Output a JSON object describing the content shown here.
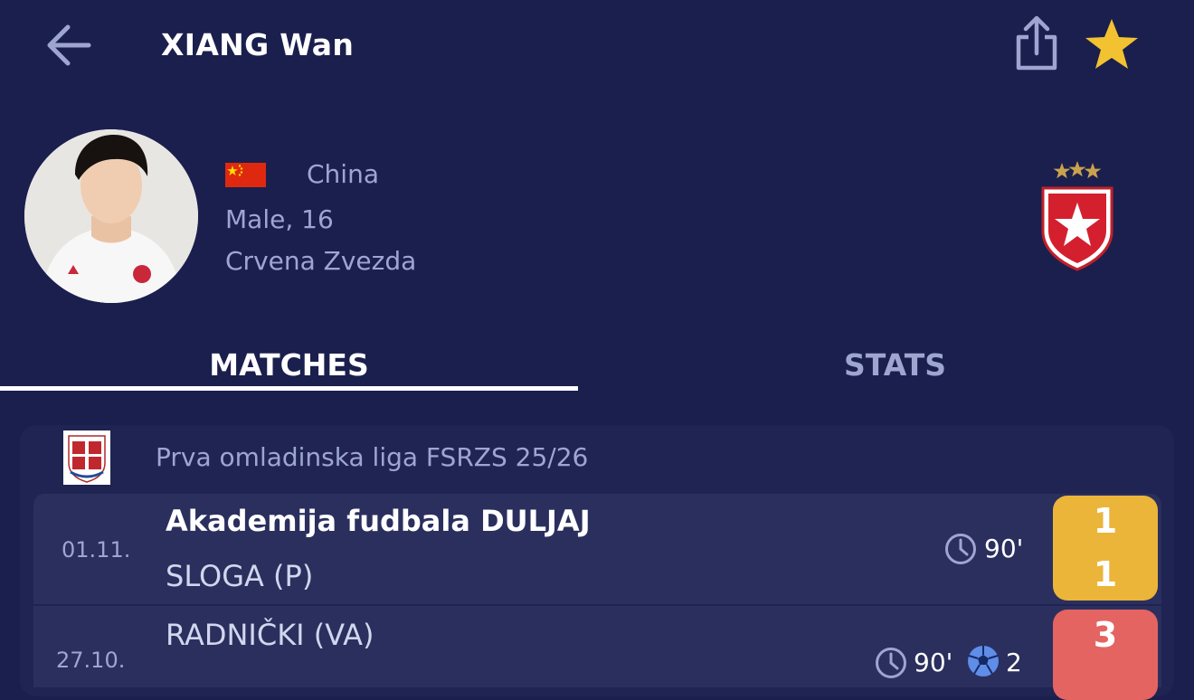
{
  "header": {
    "title": "XIANG Wan"
  },
  "player": {
    "country": "China",
    "gender_age": "Male, 16",
    "club": "Crvena Zvezda"
  },
  "tabs": [
    {
      "label": "MATCHES",
      "active": true
    },
    {
      "label": "STATS",
      "active": false
    }
  ],
  "league": {
    "name": "Prva omladinska liga FSRZS 25/26"
  },
  "matches": [
    {
      "date": "01.11.",
      "home": "Akademija fudbala DULJAJ",
      "away": "SLOGA (P)",
      "minutes": "90'",
      "score_home": "1",
      "score_away": "1",
      "result_color": "#ebb53a"
    },
    {
      "date": "27.10.",
      "home": "RADNIČKI (VA)",
      "minutes": "90'",
      "goals": "2",
      "score_home": "3",
      "result_color": "#e46462"
    }
  ],
  "colors": {
    "background": "#1b1f4e",
    "accent_star": "#f2c230",
    "muted_text": "#9ea6d0"
  }
}
